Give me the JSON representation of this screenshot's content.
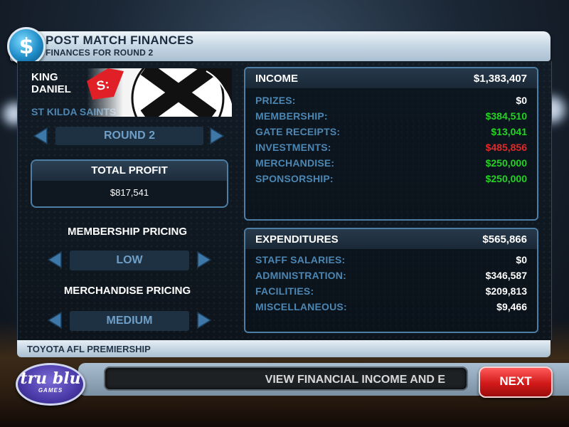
{
  "header": {
    "title": "POST MATCH FINANCES",
    "subtitle": "FINANCES FOR ROUND 2",
    "icon": "dollar-coin-icon"
  },
  "team": {
    "manager_name": "KING DANIEL",
    "club_name": "ST KILDA SAINTS",
    "logo_icon": "st-kilda-saints-logo"
  },
  "round_selector": {
    "value": "ROUND 2"
  },
  "total_profit": {
    "label": "TOTAL PROFIT",
    "value": "$817,541"
  },
  "membership_pricing": {
    "label": "MEMBERSHIP PRICING",
    "value": "LOW"
  },
  "merchandise_pricing": {
    "label": "MERCHANDISE PRICING",
    "value": "MEDIUM"
  },
  "income": {
    "label": "INCOME",
    "total": "$1,383,407",
    "rows": [
      {
        "label": "PRIZES:",
        "value": "$0",
        "color": "#ffffff"
      },
      {
        "label": "MEMBERSHIP:",
        "value": "$384,510",
        "color": "#22d322"
      },
      {
        "label": "GATE RECEIPTS:",
        "value": "$13,041",
        "color": "#22d322"
      },
      {
        "label": "INVESTMENTS:",
        "value": "$485,856",
        "color": "#e02a2a"
      },
      {
        "label": "MERCHANDISE:",
        "value": "$250,000",
        "color": "#22d322"
      },
      {
        "label": "SPONSORSHIP:",
        "value": "$250,000",
        "color": "#22d322"
      }
    ]
  },
  "expenditures": {
    "label": "EXPENDITURES",
    "total": "$565,866",
    "rows": [
      {
        "label": "STAFF SALARIES:",
        "value": "$0",
        "color": "#ffffff"
      },
      {
        "label": "ADMINISTRATION:",
        "value": "$346,587",
        "color": "#ffffff"
      },
      {
        "label": "FACILITIES:",
        "value": "$209,813",
        "color": "#ffffff"
      },
      {
        "label": "MISCELLANEOUS:",
        "value": "$9,466",
        "color": "#ffffff"
      }
    ]
  },
  "footer": {
    "competition": "TOYOTA AFL PREMIERSHIP"
  },
  "bottom": {
    "ticker_text": "VIEW FINANCIAL INCOME AND E",
    "next_label": "NEXT",
    "brand_main": "tru blu",
    "brand_sub": "GAMES"
  },
  "colors": {
    "accent_blue": "#4c86b3",
    "income_green": "#22d322",
    "loss_red": "#e02a2a",
    "next_red": "#d11919"
  }
}
